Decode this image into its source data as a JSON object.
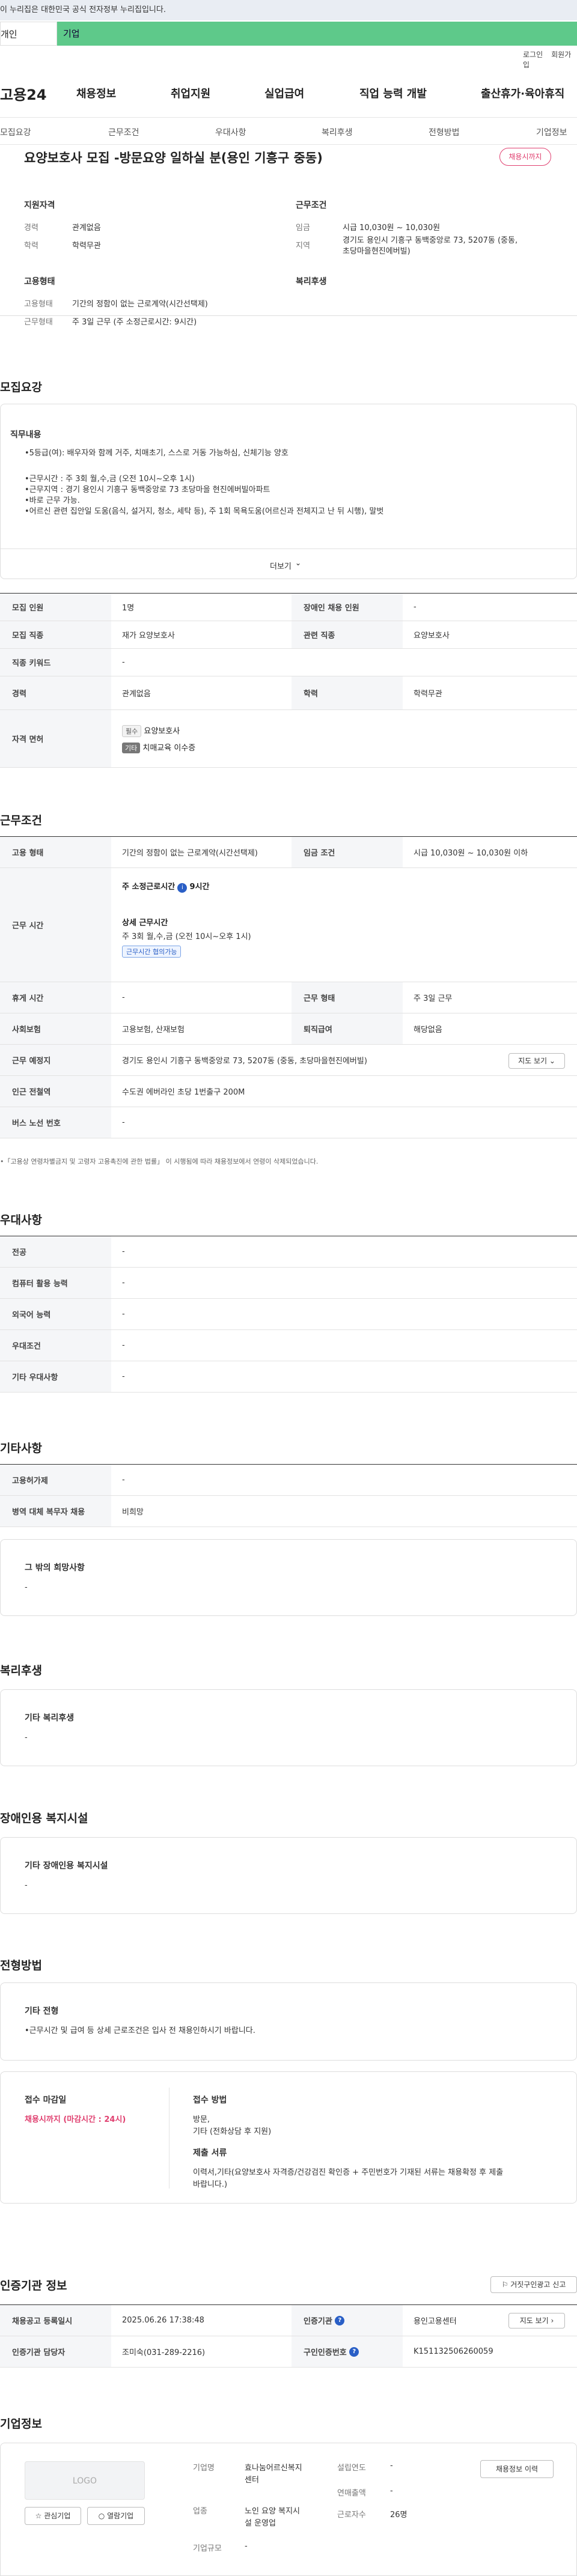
{
  "gov_banner": "이 누리집은 대한민국 공식 전자정부 누리집입니다.",
  "top_tabs": {
    "first": "개인",
    "second": "기업"
  },
  "util": {
    "login": "로그인",
    "signup": "회원가입"
  },
  "gnb": {
    "logo": "고용24",
    "items": [
      "채용정보",
      "취업지원",
      "실업급여",
      "직업 능력 개발",
      "출산휴가·육아휴직"
    ]
  },
  "lnb": [
    "모집요강",
    "근무조건",
    "우대사항",
    "복리후생",
    "전형방법",
    "기업정보"
  ],
  "job": {
    "title": "요양보호사 모집 -방문요양 일하실 분(용인 기흥구 중동)",
    "deadline_badge": "채용시까지",
    "left_groups": [
      {
        "head": "지원자격",
        "rows": [
          {
            "k": "경력",
            "v": "관계없음"
          },
          {
            "k": "학력",
            "v": "학력무관"
          }
        ]
      },
      {
        "head": "고용형태",
        "rows": [
          {
            "k": "고용형태",
            "v": "기간의 정함이 없는 근로계약(시간선택제)"
          },
          {
            "k": "근무형태",
            "v": "주 3일 근무 (주 소정근로시간: 9시간)"
          }
        ]
      }
    ],
    "right_groups": [
      {
        "head": "근무조건",
        "rows": [
          {
            "k": "임금",
            "v": "시급 10,030원 ~ 10,030원"
          },
          {
            "k": "지역",
            "v": "경기도 용인시 기흥구 동백중앙로 73, 5207동 (중동,",
            "v2": "초당마을현진에버빌)"
          }
        ]
      },
      {
        "head": "복리후생",
        "rows": []
      }
    ]
  },
  "recruit": {
    "title": "모집요강",
    "desc_head": "직무내용",
    "desc_lines": [
      "•5등급(여): 배우자와 함께 거주, 치매초기, 스스로 거동 가능하심, 신체기능 양호",
      "",
      "•근무시간 : 주 3회 월,수,금 (오전 10시~오후 1시)",
      "•근무지역 : 경기 용인시 기흥구 동백중앙로 73 초당마을 현진에버빌아파트",
      "•바로 근무 가능.",
      "•어르신 관련 집안일 도움(음식, 설거지, 청소, 세탁 등), 주 1회 목욕도움(어르신과 전체지고 난 뒤 시행), 말벗"
    ],
    "more": "더보기",
    "table": [
      {
        "k1": "모집 인원",
        "v1": "1명",
        "k2": "장애인 채용 인원",
        "v2": "-"
      },
      {
        "k1": "모집 직종",
        "v1": "재가 요양보호사",
        "k2": "관련 직종",
        "v2": "요양보호사"
      },
      {
        "k1": "직종 키워드",
        "v1": "-"
      },
      {
        "k1": "경력",
        "v1": "관계없음",
        "k2": "학력",
        "v2": "학력무관"
      }
    ],
    "license_key": "자격 면허",
    "licenses": [
      {
        "tag": "필수",
        "name": "요양보호사"
      },
      {
        "tag": "기타",
        "name": "치매교육 이수증"
      }
    ]
  },
  "work": {
    "title": "근무조건",
    "type_k": "고용 형태",
    "type_v": "기간의 정함이 없는 근로계약(시간선택제)",
    "wage_k": "임금 조건",
    "wage_v": "시급 10,030원 ~ 10,030원 이하",
    "hours_k": "근무 시간",
    "hours_week": "주 소정근로시간",
    "hours_week_v": "9시간",
    "hours_detail_head": "상세 근무시간",
    "hours_detail": "주 3회 월,수,금 (오전 10시~오후 1시)",
    "hours_tag": "근무시간 협의가능",
    "rows": [
      {
        "k1": "휴게 시간",
        "v1": "-",
        "k2": "근무 형태",
        "v2": "주 3일 근무"
      },
      {
        "k1": "사회보험",
        "v1": "고용보험, 산재보험",
        "k2": "퇴직급여",
        "v2": "해당없음"
      }
    ],
    "place_k": "근무 예정지",
    "place_v": "경기도 용인시 기흥구 동백중앙로 73, 5207동 (중동, 초당마을현진에버빌)",
    "map_btn": "지도 보기",
    "station_k": "인근 전철역",
    "station_v": "수도권 에버라인 초당 1번출구 200M",
    "bus_k": "버스 노선 번호",
    "bus_v": "-",
    "footnote": "•「고용상 연령차별금지 및 고령자 고용촉진에 관한 법률」 이 시행됨에 따라 채용정보에서 연령이 삭제되었습니다."
  },
  "pref": {
    "title": "우대사항",
    "rows": [
      {
        "k": "전공",
        "v": "-"
      },
      {
        "k": "컴퓨터 활용 능력",
        "v": "-"
      },
      {
        "k": "외국어 능력",
        "v": "-"
      },
      {
        "k": "우대조건",
        "v": "-"
      },
      {
        "k": "기타 우대사항",
        "v": "-"
      }
    ]
  },
  "etc": {
    "title": "기타사항",
    "rows": [
      {
        "k": "고용허가제",
        "v": "-"
      },
      {
        "k": "병역 대체 복무자 채용",
        "v": "비희망"
      }
    ],
    "box_head": "그 밖의 희망사항",
    "box_v": "-"
  },
  "welfare": {
    "title": "복리후생",
    "box_head": "기타 복리후생",
    "box_v": "-"
  },
  "disabled": {
    "title": "장애인용 복지시설",
    "box_head": "기타 장애인용 복지시설",
    "box_v": "-"
  },
  "selection": {
    "title": "전형방법",
    "box_head": "기타 전형",
    "box_v": "•근무시간 및 급여 등 상세 근로조건은 입사 전 채용인하시기 바랍니다.",
    "deadline_head": "접수 마감일",
    "deadline_v": "채용시까지 (마감시간 : 24시)",
    "method_head": "접수 방법",
    "method_v1": "방문,",
    "method_v2": "기타 (전화상담 후 지원)",
    "docs_head": "제출 서류",
    "docs_v1": "이력서,기타(요양보호사 자격증/건강검진 확인증 + 주민번호가 기재된 서류는 채용확정 후 제출",
    "docs_v2": "바랍니다.)"
  },
  "agency": {
    "title": "인증기관 정보",
    "report_btn": "거짓구인광고 신고",
    "rows": [
      {
        "k1": "채용공고 등록일시",
        "v1": "2025.06.26 17:38:48",
        "k2": "인증기관",
        "v2": "용인고용센터"
      },
      {
        "k1": "인증기관 담당자",
        "v1": "조미숙(031-289-2216)",
        "k2": "구인인증번호",
        "v2": "K151132506260059"
      }
    ],
    "map_btn": "지도 보기"
  },
  "company": {
    "title": "기업정보",
    "logo": "LOGO",
    "interest_btn": "관심기업",
    "list_btn": "열람기업",
    "name_k": "기업명",
    "name_v1": "효나눔어르신복지",
    "name_v2": "센터",
    "biz_k": "업종",
    "biz_v1": "노인 요양 복지시",
    "biz_v2": "설 운영업",
    "size_k": "기업규모",
    "size_v": "-",
    "founded_k": "설립연도",
    "founded_v": "-",
    "sales_k": "연매출액",
    "sales_v": "-",
    "emp_k": "근로자수",
    "emp_v": "26명",
    "history_btn": "채용정보 이력"
  }
}
